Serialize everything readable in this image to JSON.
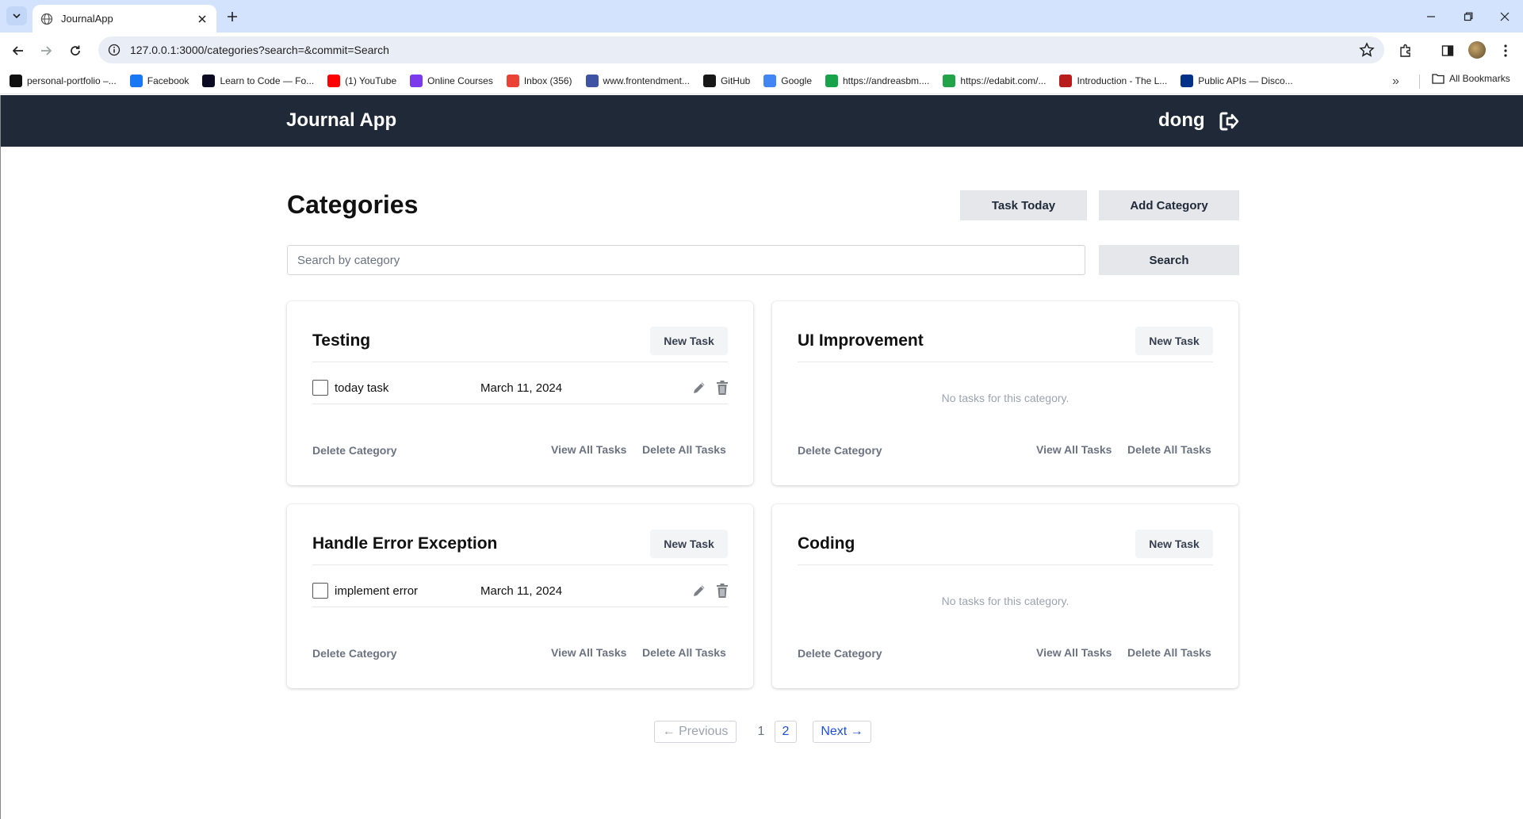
{
  "browser": {
    "tab_title": "JournalApp",
    "url": "127.0.0.1:3000/categories?search=&commit=Search",
    "bookmarks": [
      {
        "label": "personal-portfolio –...",
        "icon": "triangle-logo-icon",
        "color": "#111111"
      },
      {
        "label": "Facebook",
        "icon": "facebook-icon",
        "color": "#1877f2"
      },
      {
        "label": "Learn to Code — Fo...",
        "icon": "freecodecamp-icon",
        "color": "#0a0a23"
      },
      {
        "label": "(1) YouTube",
        "icon": "youtube-icon",
        "color": "#ff0000"
      },
      {
        "label": "Online Courses",
        "icon": "courses-icon",
        "color": "#7c3aed"
      },
      {
        "label": "Inbox (356)",
        "icon": "gmail-icon",
        "color": "#ea4335"
      },
      {
        "label": "www.frontendment...",
        "icon": "frontendmentor-icon",
        "color": "#3e54a3"
      },
      {
        "label": "GitHub",
        "icon": "github-icon",
        "color": "#181717"
      },
      {
        "label": "Google",
        "icon": "google-icon",
        "color": "#4285f4"
      },
      {
        "label": "https://andreasbm....",
        "icon": "cloud-icon",
        "color": "#16a34a"
      },
      {
        "label": "https://edabit.com/...",
        "icon": "edabit-icon",
        "color": "#22a34a"
      },
      {
        "label": "Introduction - The L...",
        "icon": "rust-icon",
        "color": "#b91c1c"
      },
      {
        "label": "Public APIs — Disco...",
        "icon": "paypal-icon",
        "color": "#003087"
      }
    ],
    "all_bookmarks": "All Bookmarks"
  },
  "app": {
    "brand": "Journal App",
    "username": "dong",
    "title": "Categories",
    "task_today_label": "Task Today",
    "add_category_label": "Add Category",
    "search_placeholder": "Search by category",
    "search_label": "Search"
  },
  "categories": [
    {
      "name": "Testing",
      "new_task": "New Task",
      "task": {
        "name": "today task",
        "date": "March 11, 2024"
      },
      "delete_category": "Delete Category",
      "view_all": "View All Tasks",
      "delete_all": "Delete All Tasks"
    },
    {
      "name": "UI Improvement",
      "new_task": "New Task",
      "empty": "No tasks for this category.",
      "delete_category": "Delete Category",
      "view_all": "View All Tasks",
      "delete_all": "Delete All Tasks"
    },
    {
      "name": "Handle Error Exception",
      "new_task": "New Task",
      "task": {
        "name": "implement error",
        "date": "March 11, 2024"
      },
      "delete_category": "Delete Category",
      "view_all": "View All Tasks",
      "delete_all": "Delete All Tasks"
    },
    {
      "name": "Coding",
      "new_task": "New Task",
      "empty": "No tasks for this category.",
      "delete_category": "Delete Category",
      "view_all": "View All Tasks",
      "delete_all": "Delete All Tasks"
    }
  ],
  "pagination": {
    "previous": "← Previous",
    "pages": [
      "1",
      "2"
    ],
    "current": "2",
    "next": "Next →"
  },
  "colors": {
    "appbar": "#1f2937",
    "button_gray": "#e5e7eb",
    "link_blue": "#1d4ed8"
  }
}
